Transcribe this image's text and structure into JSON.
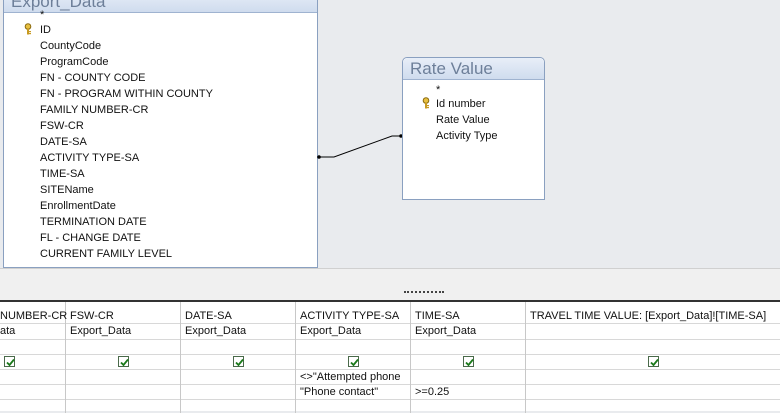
{
  "export_data": {
    "title": "Export_Data",
    "fields": [
      "*",
      "ID",
      "CountyCode",
      "ProgramCode",
      "FN - COUNTY CODE",
      "FN - PROGRAM WITHIN COUNTY",
      "FAMILY NUMBER-CR",
      "FSW-CR",
      "DATE-SA",
      "ACTIVITY TYPE-SA",
      "TIME-SA",
      "SITEName",
      "EnrollmentDate",
      "TERMINATION DATE",
      "FL - CHANGE DATE",
      "CURRENT FAMILY LEVEL"
    ]
  },
  "rate_value": {
    "title": "Rate Value",
    "fields": [
      "*",
      "Id number",
      "Rate Value",
      "Activity Type"
    ]
  },
  "grid": {
    "columns": [
      {
        "field": "NUMBER-CR",
        "table": "ata",
        "show": true,
        "criteria": "",
        "or": ""
      },
      {
        "field": "FSW-CR",
        "table": "Export_Data",
        "show": true,
        "criteria": "",
        "or": ""
      },
      {
        "field": "DATE-SA",
        "table": "Export_Data",
        "show": true,
        "criteria": "",
        "or": ""
      },
      {
        "field": "ACTIVITY TYPE-SA",
        "table": "Export_Data",
        "show": true,
        "criteria": "<>\"Attempted phone",
        "or": "\"Phone contact\""
      },
      {
        "field": "TIME-SA",
        "table": "Export_Data",
        "show": true,
        "criteria": "",
        "or": ">=0.25"
      },
      {
        "field": "TRAVEL TIME VALUE: [Export_Data]![TIME-SA]",
        "table": "",
        "show": true,
        "criteria": "",
        "or": ""
      }
    ]
  }
}
